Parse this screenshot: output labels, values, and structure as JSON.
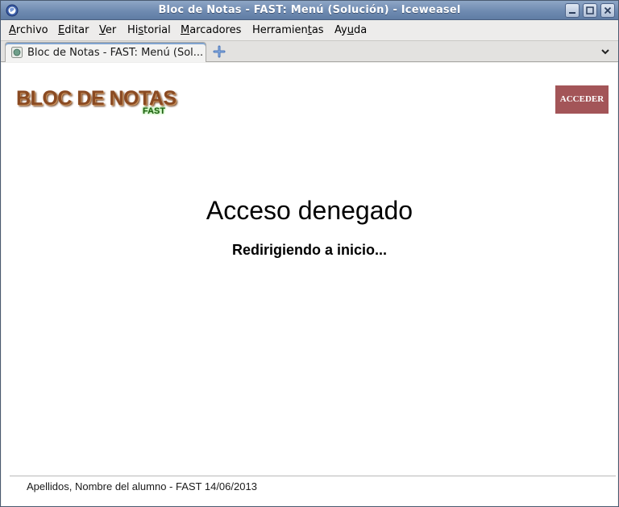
{
  "window": {
    "title": "Bloc de Notas - FAST: Menú (Solución) - Iceweasel"
  },
  "menubar": {
    "items": [
      {
        "pre": "",
        "key": "A",
        "post": "rchivo"
      },
      {
        "pre": "",
        "key": "E",
        "post": "ditar"
      },
      {
        "pre": "",
        "key": "V",
        "post": "er"
      },
      {
        "pre": "Hi",
        "key": "s",
        "post": "torial"
      },
      {
        "pre": "",
        "key": "M",
        "post": "arcadores"
      },
      {
        "pre": "Herramien",
        "key": "t",
        "post": "as"
      },
      {
        "pre": "Ay",
        "key": "u",
        "post": "da"
      }
    ]
  },
  "tabs": {
    "active_label": "Bloc de Notas - FAST: Menú (Sol..."
  },
  "page": {
    "logo_main": "BLOC DE NOTAS",
    "logo_sub": "FAST",
    "login_button": "ACCEDER",
    "heading": "Acceso denegado",
    "subheading": "Redirigiendo a inicio...",
    "footer": "Apellidos, Nombre del alumno - FAST 14/06/2013"
  },
  "colors": {
    "login_button_bg": "#a35558",
    "logo_brown": "#8a4a22",
    "logo_green": "#1d5e12"
  },
  "icons": {
    "app": "iceweasel-icon",
    "favicon": "globe-favicon-icon",
    "new_tab": "plus-icon",
    "tab_list": "chevron-down-icon",
    "minimize": "minimize-icon",
    "maximize": "maximize-icon",
    "close": "close-icon"
  }
}
